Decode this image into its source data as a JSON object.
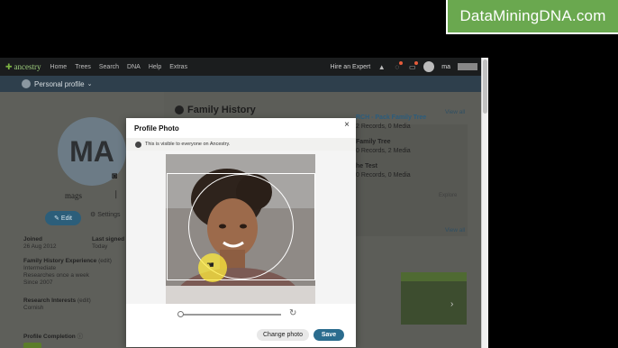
{
  "watermark": "DataMiningDNA.com",
  "topnav": {
    "logo": "ancestry",
    "links": [
      "Home",
      "Trees",
      "Search",
      "DNA",
      "Help",
      "Extras"
    ],
    "hire": "Hire an Expert",
    "username": "ma"
  },
  "subbar": {
    "label": "Personal profile"
  },
  "profile": {
    "initials": "MA",
    "name": "mags",
    "edit": "Edit",
    "settings": "Settings",
    "joined_label": "Joined",
    "joined_value": "26 Aug 2012",
    "last_signed_label": "Last signed",
    "last_signed_value": "Today",
    "fhe_label": "Family History Experience",
    "fhe_edit": "(edit)",
    "fhe_level": "Intermediate",
    "fhe_freq": "Researches once a week",
    "fhe_since": "Since 2007",
    "ri_label": "Research Interests",
    "ri_edit": "(edit)",
    "ri_value": "Cornish",
    "completion_label": "Profile Completion"
  },
  "family_history": {
    "title": "Family History",
    "view_all": "View all",
    "trees": [
      {
        "name": "RCH - Pack Family Tree",
        "stats": "2 Records, 0 Media"
      },
      {
        "name": "Family Tree",
        "stats": "0 Records, 2 Media"
      },
      {
        "name": "he Test",
        "stats": "0 Records, 0 Media"
      }
    ],
    "explore": "Explore"
  },
  "photos": {
    "view_all": "View all"
  },
  "modal": {
    "title": "Profile Photo",
    "close": "×",
    "visibility": "This is visible to everyone on Ancestry.",
    "change_photo": "Change photo",
    "save": "Save",
    "zoom": 0.02
  }
}
